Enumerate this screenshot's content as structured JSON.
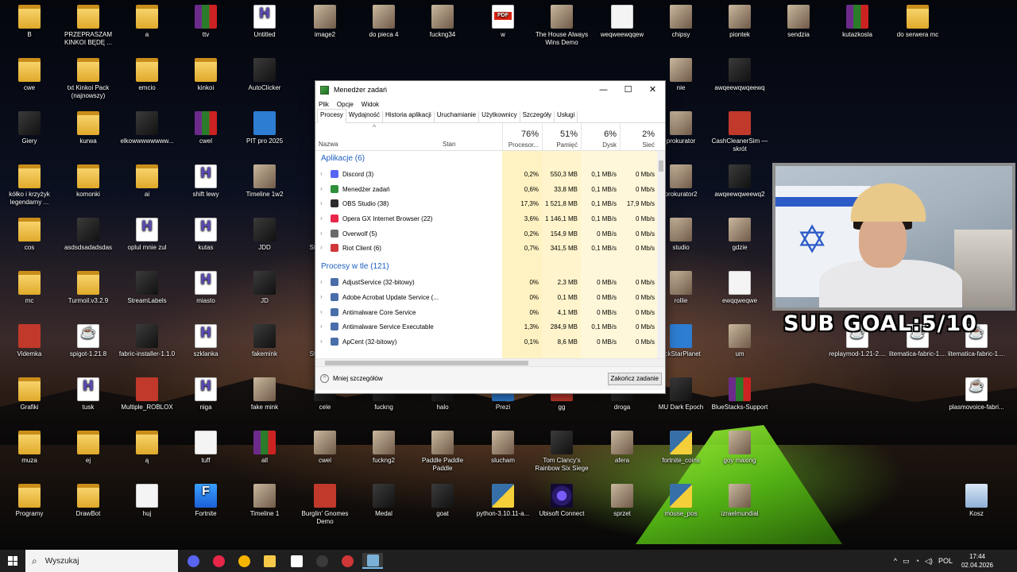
{
  "desktop_icons": [
    {
      "label": "B",
      "type": "folder"
    },
    {
      "label": "PRZEPRASZAM KINKOI BĘDĘ ...",
      "type": "folder"
    },
    {
      "label": "a",
      "type": "folder"
    },
    {
      "label": "ttv",
      "type": "rar"
    },
    {
      "label": "Untitled",
      "type": "h"
    },
    {
      "label": "image2",
      "type": "pic"
    },
    {
      "label": "do pieca 4",
      "type": "pic"
    },
    {
      "label": "fuckng34",
      "type": "pic"
    },
    {
      "label": "w",
      "type": "pdf"
    },
    {
      "label": "The House Always Wins Demo",
      "type": "pic"
    },
    {
      "label": "weqweewqqew",
      "type": "file"
    },
    {
      "label": "chipsy",
      "type": "pic"
    },
    {
      "label": "piontek",
      "type": "pic"
    },
    {
      "label": "sendzia",
      "type": "pic"
    },
    {
      "label": "kutazkosla",
      "type": "rar"
    },
    {
      "label": "do serwera mc",
      "type": "folder"
    },
    {
      "label": "cwe",
      "type": "folder"
    },
    {
      "label": "txt Kinkoi Pack (najnowszy)",
      "type": "folder"
    },
    {
      "label": "emcio",
      "type": "folder"
    },
    {
      "label": "kinkoi",
      "type": "folder"
    },
    {
      "label": "AutoClicker",
      "type": "dark"
    },
    {
      "label": "nie",
      "type": "pic"
    },
    {
      "label": "awqeewqwqeewq",
      "type": "dark"
    },
    {
      "label": "Giery",
      "type": "dark"
    },
    {
      "label": "kurwa",
      "type": "folder"
    },
    {
      "label": "elkowwwwwwww...",
      "type": "dark"
    },
    {
      "label": "cwel",
      "type": "rar"
    },
    {
      "label": "PIT pro 2025",
      "type": "blue"
    },
    {
      "label": "prokurator",
      "type": "pic"
    },
    {
      "label": "CashCleanerSim — skrót",
      "type": "red"
    },
    {
      "label": "kółko i krzyżyk legendarny ...",
      "type": "folder"
    },
    {
      "label": "komonki",
      "type": "folder"
    },
    {
      "label": "ai",
      "type": "folder"
    },
    {
      "label": "shift lewy",
      "type": "h"
    },
    {
      "label": "Timeline 1w2",
      "type": "pic"
    },
    {
      "label": "prokurator2",
      "type": "pic"
    },
    {
      "label": "awqeewqweewq2",
      "type": "dark"
    },
    {
      "label": "cos",
      "type": "folder"
    },
    {
      "label": "asdsdsadadsdas",
      "type": "dark"
    },
    {
      "label": "oplul mnie zul",
      "type": "h"
    },
    {
      "label": "kutas",
      "type": "h"
    },
    {
      "label": "JDD",
      "type": "dark"
    },
    {
      "label": "studio",
      "type": "pic"
    },
    {
      "label": "gdzie",
      "type": "pic"
    },
    {
      "label": "mc",
      "type": "folder"
    },
    {
      "label": "Turmoil.v3.2.9",
      "type": "folder"
    },
    {
      "label": "StreamLabels",
      "type": "dark"
    },
    {
      "label": "miasto",
      "type": "h"
    },
    {
      "label": "JD",
      "type": "dark"
    },
    {
      "label": "rollie",
      "type": "pic"
    },
    {
      "label": "ewqqweqwe",
      "type": "file"
    },
    {
      "label": "Videmka",
      "type": "red"
    },
    {
      "label": "spigot-1.21.8",
      "type": "java"
    },
    {
      "label": "fabric-installer-1.1.0",
      "type": "dark"
    },
    {
      "label": "szklanka",
      "type": "h"
    },
    {
      "label": "fakemink",
      "type": "dark"
    },
    {
      "label": "ockStarPlanet",
      "type": "blue"
    },
    {
      "label": "um",
      "type": "pic"
    },
    {
      "label": "replaymod-1.21-2....",
      "type": "java"
    },
    {
      "label": "litematica-fabric-1....",
      "type": "java"
    },
    {
      "label": "litematica-fabric-1....",
      "type": "java"
    },
    {
      "label": "Grafiki",
      "type": "folder"
    },
    {
      "label": "tusk",
      "type": "h"
    },
    {
      "label": "Multiple_ROBLOX",
      "type": "red"
    },
    {
      "label": "niga",
      "type": "h"
    },
    {
      "label": "fake mink",
      "type": "pic"
    },
    {
      "label": "cele",
      "type": "dark"
    },
    {
      "label": "fuckng",
      "type": "dark"
    },
    {
      "label": "halo",
      "type": "dark"
    },
    {
      "label": "Prezi",
      "type": "blue"
    },
    {
      "label": "gg",
      "type": "red"
    },
    {
      "label": "droga",
      "type": "dark"
    },
    {
      "label": "MU Dark Epoch",
      "type": "dark"
    },
    {
      "label": "BlueStacks-Support",
      "type": "rar"
    },
    {
      "label": "plasmovoice-fabri...",
      "type": "java"
    },
    {
      "label": "muza",
      "type": "folder"
    },
    {
      "label": "ej",
      "type": "folder"
    },
    {
      "label": "ą",
      "type": "folder"
    },
    {
      "label": "tuff",
      "type": "file"
    },
    {
      "label": "all",
      "type": "rar"
    },
    {
      "label": "cwel",
      "type": "pic"
    },
    {
      "label": "fuckng2",
      "type": "pic"
    },
    {
      "label": "Paddle Paddle Paddle",
      "type": "pic"
    },
    {
      "label": "slucham",
      "type": "pic"
    },
    {
      "label": "Tom Clancy's Rainbow Six Siege",
      "type": "dark"
    },
    {
      "label": "afera",
      "type": "pic"
    },
    {
      "label": "fortnite_coins",
      "type": "py"
    },
    {
      "label": "goy maxing",
      "type": "pic"
    },
    {
      "label": "Programy",
      "type": "folder"
    },
    {
      "label": "DrawBot",
      "type": "folder"
    },
    {
      "label": "huj",
      "type": "file"
    },
    {
      "label": "Fortnite",
      "type": "fort"
    },
    {
      "label": "Timeline 1",
      "type": "pic"
    },
    {
      "label": "Burglin' Gnomes Demo",
      "type": "red"
    },
    {
      "label": "Medal",
      "type": "dark"
    },
    {
      "label": "goat",
      "type": "dark"
    },
    {
      "label": "python-3.10.11-a...",
      "type": "py"
    },
    {
      "label": "Ubisoft Connect",
      "type": "ubi"
    },
    {
      "label": "sprzet",
      "type": "pic"
    },
    {
      "label": "mouse_pos",
      "type": "py"
    },
    {
      "label": "izraelmundial",
      "type": "pic"
    },
    {
      "label": "Kosz",
      "type": "bin"
    },
    {
      "label": "Stre",
      "type": "none"
    },
    {
      "label": "Stre",
      "type": "none"
    }
  ],
  "task_manager": {
    "title": "Menedżer zadań",
    "menu": [
      "Plik",
      "Opcje",
      "Widok"
    ],
    "tabs": [
      "Procesy",
      "Wydajność",
      "Historia aplikacji",
      "Uruchamianie",
      "Użytkownicy",
      "Szczegóły",
      "Usługi"
    ],
    "active_tab": "Procesy",
    "columns": {
      "name": "Nazwa",
      "status": "Stan",
      "cpu_pct": "76%",
      "cpu": "Procesor...",
      "mem_pct": "51%",
      "mem": "Pamięć",
      "disk_pct": "6%",
      "disk": "Dysk",
      "net_pct": "2%",
      "net": "Sieć"
    },
    "groups": [
      {
        "title": "Aplikacje (6)",
        "rows": [
          {
            "name": "Discord (3)",
            "icon_color": "#5865f2",
            "cpu": "0,2%",
            "mem": "550,3 MB",
            "disk": "0,1 MB/s",
            "net": "0 Mb/s"
          },
          {
            "name": "Menedżer zadań",
            "icon_color": "#2f8f3a",
            "cpu": "0,6%",
            "mem": "33,8 MB",
            "disk": "0,1 MB/s",
            "net": "0 Mb/s"
          },
          {
            "name": "OBS Studio (38)",
            "icon_color": "#2b2b2b",
            "cpu": "17,3%",
            "mem": "1 521,8 MB",
            "disk": "0,1 MB/s",
            "net": "17,9 Mb/s"
          },
          {
            "name": "Opera GX Internet Browser (22)",
            "icon_color": "#e8264a",
            "cpu": "3,6%",
            "mem": "1 146,1 MB",
            "disk": "0,1 MB/s",
            "net": "0 Mb/s"
          },
          {
            "name": "Overwolf (5)",
            "icon_color": "#6b6b6b",
            "cpu": "0,2%",
            "mem": "154,9 MB",
            "disk": "0 MB/s",
            "net": "0 Mb/s"
          },
          {
            "name": "Riot Client (6)",
            "icon_color": "#d13639",
            "cpu": "0,7%",
            "mem": "341,5 MB",
            "disk": "0,1 MB/s",
            "net": "0 Mb/s"
          }
        ]
      },
      {
        "title": "Procesy w tle (121)",
        "rows": [
          {
            "name": "AdjustService (32-bitowy)",
            "icon_color": "#4a6ea9",
            "cpu": "0%",
            "mem": "2,3 MB",
            "disk": "0 MB/s",
            "net": "0 Mb/s"
          },
          {
            "name": "Adobe Acrobat Update Service (...",
            "icon_color": "#4a6ea9",
            "cpu": "0%",
            "mem": "0,1 MB",
            "disk": "0 MB/s",
            "net": "0 Mb/s"
          },
          {
            "name": "Antimalware Core Service",
            "icon_color": "#4a6ea9",
            "cpu": "0%",
            "mem": "4,1 MB",
            "disk": "0 MB/s",
            "net": "0 Mb/s"
          },
          {
            "name": "Antimalware Service Executable",
            "icon_color": "#4a6ea9",
            "cpu": "1,3%",
            "mem": "284,9 MB",
            "disk": "0,1 MB/s",
            "net": "0 Mb/s"
          },
          {
            "name": "ApCent (32-bitowy)",
            "icon_color": "#4a6ea9",
            "cpu": "0,1%",
            "mem": "8,6 MB",
            "disk": "0 MB/s",
            "net": "0 Mb/s"
          }
        ]
      }
    ],
    "less_details": "Mniej szczegółów",
    "end_task": "Zakończ zadanie"
  },
  "stream_overlay": {
    "goal_text": "SUB GOAL:5/10"
  },
  "taskbar": {
    "search_placeholder": "Wyszukaj",
    "apps": [
      {
        "name": "discord",
        "color": "#5865f2"
      },
      {
        "name": "opera-gx",
        "color": "#e8264a"
      },
      {
        "name": "chrome",
        "color": "#f4b400"
      },
      {
        "name": "file-explorer",
        "color": "#f7c948"
      },
      {
        "name": "streamlabs",
        "color": "#ffffff"
      },
      {
        "name": "obs",
        "color": "#3a3a3a"
      },
      {
        "name": "riot",
        "color": "#d13639"
      },
      {
        "name": "task-manager",
        "color": "#7ab0d6"
      }
    ],
    "language": "POL",
    "time": "17:44",
    "date": "02.04.2026"
  }
}
